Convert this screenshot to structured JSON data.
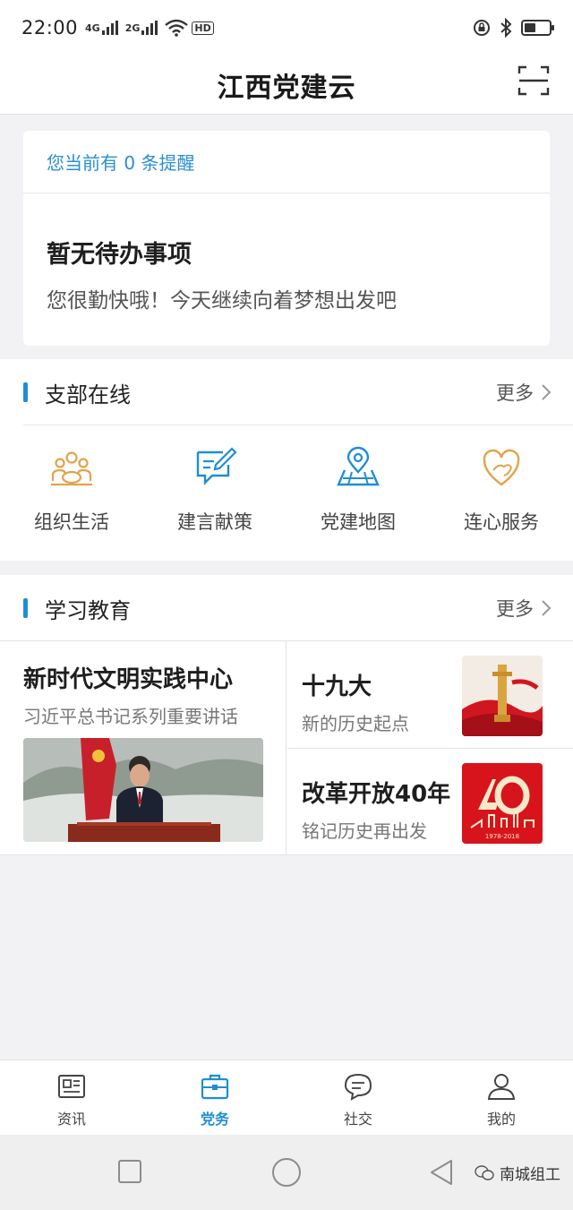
{
  "status_bar": {
    "time": "22:00",
    "net1": "4G",
    "net2": "2G",
    "wifi_badge": "HD"
  },
  "header": {
    "title": "江西党建云"
  },
  "reminder": {
    "text": "您当前有 0 条提醒",
    "todo_title": "暂无待办事项",
    "todo_sub": "您很勤快哦！今天继续向着梦想出发吧"
  },
  "branch_online": {
    "title": "支部在线",
    "more": "更多",
    "items": [
      {
        "label": "组织生活",
        "icon": "group-meeting-icon"
      },
      {
        "label": "建言献策",
        "icon": "suggestion-edit-icon"
      },
      {
        "label": "党建地图",
        "icon": "map-pin-icon"
      },
      {
        "label": "连心服务",
        "icon": "heart-hands-icon"
      }
    ],
    "colors": {
      "orange": "#e3a24d",
      "blue": "#1e8ed3"
    }
  },
  "study": {
    "title": "学习教育",
    "more": "更多",
    "main": {
      "title": "新时代文明实践中心",
      "subtitle": "习近平总书记系列重要讲话"
    },
    "items": [
      {
        "title": "十九大",
        "subtitle": "新的历史起点"
      },
      {
        "title": "改革开放40年",
        "subtitle": "铭记历史再出发",
        "badge_text": "1978-2018"
      }
    ]
  },
  "tabbar": {
    "tabs": [
      {
        "label": "资讯",
        "icon": "newspaper-icon",
        "active": false
      },
      {
        "label": "党务",
        "icon": "briefcase-icon",
        "active": true
      },
      {
        "label": "社交",
        "icon": "chat-bubble-icon",
        "active": false
      },
      {
        "label": "我的",
        "icon": "user-icon",
        "active": false
      }
    ],
    "active_color": "#1e8ed3"
  },
  "watermark": {
    "text": "南城组工"
  }
}
